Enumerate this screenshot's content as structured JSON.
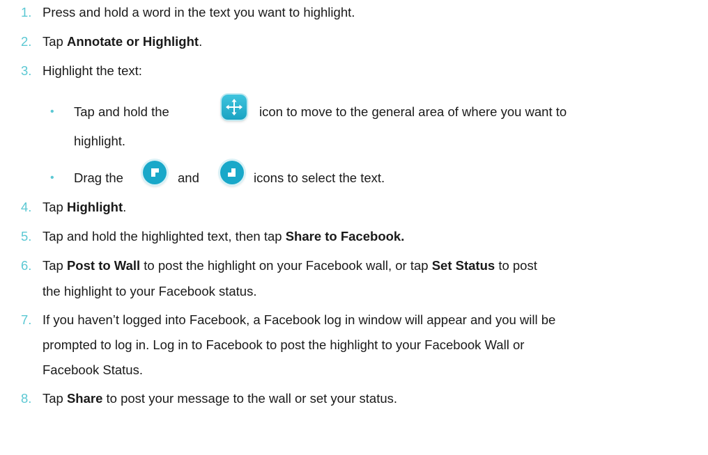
{
  "steps": [
    {
      "n": "1.",
      "text": "Press and hold a word in the text you want to highlight."
    },
    {
      "n": "2.",
      "pre": "Tap ",
      "bold": "Annotate or Highlight",
      "post": "."
    },
    {
      "n": "3.",
      "text": "Highlight the text:"
    },
    {
      "n": "4.",
      "pre": "Tap ",
      "bold": "Highlight",
      "post": "."
    },
    {
      "n": "5.",
      "pre": "Tap and hold the highlighted text, then tap ",
      "bold": "Share to Facebook."
    },
    {
      "n": "6.",
      "pre": "Tap ",
      "bold": "Post to Wall",
      "mid": " to post the highlight on your Facebook wall, or tap ",
      "bold2": "Set Status",
      "post": " to post",
      "cont": "the highlight to your Facebook status."
    },
    {
      "n": "7.",
      "lines": [
        "If you haven’t logged into Facebook, a Facebook log in window will appear and you will be",
        "prompted to log in. Log in to Facebook to post the highlight to your Facebook Wall or",
        "Facebook Status."
      ]
    },
    {
      "n": "8.",
      "pre": "Tap ",
      "bold": "Share",
      "post": " to post your message to the wall or set your status."
    }
  ],
  "substeps": [
    {
      "bullet": "•",
      "pre": "Tap and hold the ",
      "icon": "move-icon",
      "post": " icon to move to the general area of where you want to",
      "cont": "highlight."
    },
    {
      "bullet": "•",
      "pre": "Drag the ",
      "icon1": "start-handle-icon",
      "mid": " and ",
      "icon2": "end-handle-icon",
      "post": " icons to select the text."
    }
  ],
  "colors": {
    "number": "#5bc8d3",
    "icon": "#19a8c9"
  }
}
